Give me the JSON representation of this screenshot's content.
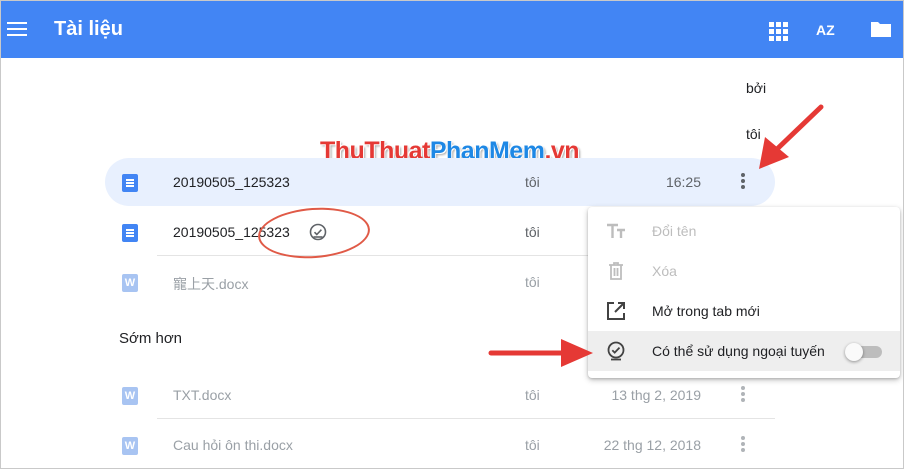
{
  "app": {
    "title": "Tài liệu"
  },
  "toolbar": {
    "menu_icon": "hamburger-menu-icon",
    "view_icon": "grid-view-icon",
    "sort_label": "AZ",
    "sort_icon": "sort-az-icon",
    "folder_icon": "folder-icon"
  },
  "column_header": {
    "owner_line1": "bởi",
    "owner_line2": "tôi"
  },
  "watermark": {
    "part1": "ThuThuat",
    "part2": "PhanMem",
    "part3": ".vn"
  },
  "files_recent": [
    {
      "name": "20190505_125323",
      "type": "doc",
      "owner": "tôi",
      "date": "16:25",
      "selected": true
    },
    {
      "name": "20190505_125323",
      "type": "doc",
      "owner": "tôi",
      "date": "",
      "offline": true
    },
    {
      "name": "寵上天.docx",
      "type": "word",
      "owner": "tôi",
      "date": "",
      "dim": true
    }
  ],
  "section_earlier": {
    "label": "Sớm hơn"
  },
  "files_earlier": [
    {
      "name": "TXT.docx",
      "type": "word",
      "owner": "tôi",
      "date": "13 thg 2, 2019",
      "dim": true
    },
    {
      "name": "Cau hỏi ôn thi.docx",
      "type": "word",
      "owner": "tôi",
      "date": "22 thg 12, 2018",
      "dim": true
    }
  ],
  "word_icon_letter": "W",
  "context_menu": {
    "items": [
      {
        "label": "Đổi tên",
        "icon": "rename-text-icon",
        "disabled": true
      },
      {
        "label": "Xóa",
        "icon": "trash-icon",
        "disabled": true
      },
      {
        "label": "Mở trong tab mới",
        "icon": "open-in-new-tab-icon",
        "disabled": false
      },
      {
        "label": "Có thể sử dụng ngoại tuyến",
        "icon": "offline-check-icon",
        "disabled": false,
        "toggle": false
      }
    ]
  },
  "colors": {
    "topbar": "#4285f4",
    "selected_row": "#e8f0fe",
    "annotation": "#e53935"
  }
}
